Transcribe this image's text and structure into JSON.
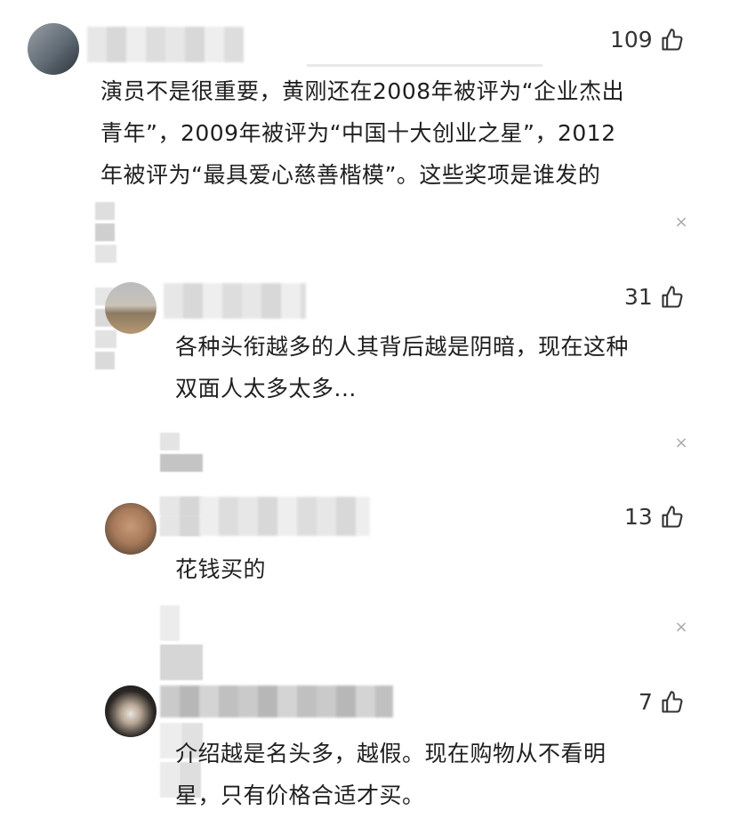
{
  "comments": [
    {
      "likes": "109",
      "text": [
        "演员不是很重要，黄刚还在2008年被评为“企业杰出",
        "青年”，2009年被评为“中国十大创业之星”，2012",
        "年被评为“最具爱心慈善楷模”。这些奖项是谁发的"
      ],
      "close": "×"
    },
    {
      "likes": "31",
      "text": [
        "各种头衔越多的人其背后越是阴暗，现在这种",
        "双面人太多太多..."
      ],
      "close": "×"
    },
    {
      "likes": "13",
      "text": [
        "花钱买的"
      ],
      "close": "×"
    },
    {
      "likes": "7",
      "text": [
        "介绍越是名头多，越假。现在购物从不看明",
        "星，只有价格合适才买。"
      ]
    }
  ],
  "icons": {
    "like": "thumbs-up-icon",
    "close": "close-icon"
  },
  "colors": {
    "text": "#1f1f1f",
    "muted": "#aaaaaa",
    "background": "#ffffff"
  }
}
